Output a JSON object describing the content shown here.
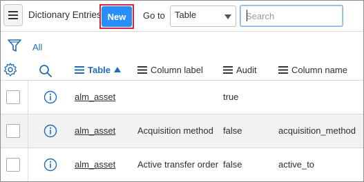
{
  "header": {
    "title": "Dictionary Entries",
    "new_label": "New",
    "goto_label": "Go to",
    "goto_select_value": "Table",
    "search_placeholder": "Search",
    "accent_color": "#278efc",
    "highlight_color": "#d0253d"
  },
  "filter": {
    "all_label": "All"
  },
  "columns": [
    {
      "label": "Table",
      "sorted": "ascending"
    },
    {
      "label": "Column label"
    },
    {
      "label": "Audit"
    },
    {
      "label": "Column name"
    }
  ],
  "rows": [
    {
      "table": "alm_asset",
      "column_label": "",
      "audit": "true",
      "column_name": ""
    },
    {
      "table": "alm_asset",
      "column_label": "Acquisition method",
      "audit": "false",
      "column_name": "acquisition_method"
    },
    {
      "table": "alm_asset",
      "column_label": "Active transfer order",
      "audit": "false",
      "column_name": "active_to"
    }
  ]
}
